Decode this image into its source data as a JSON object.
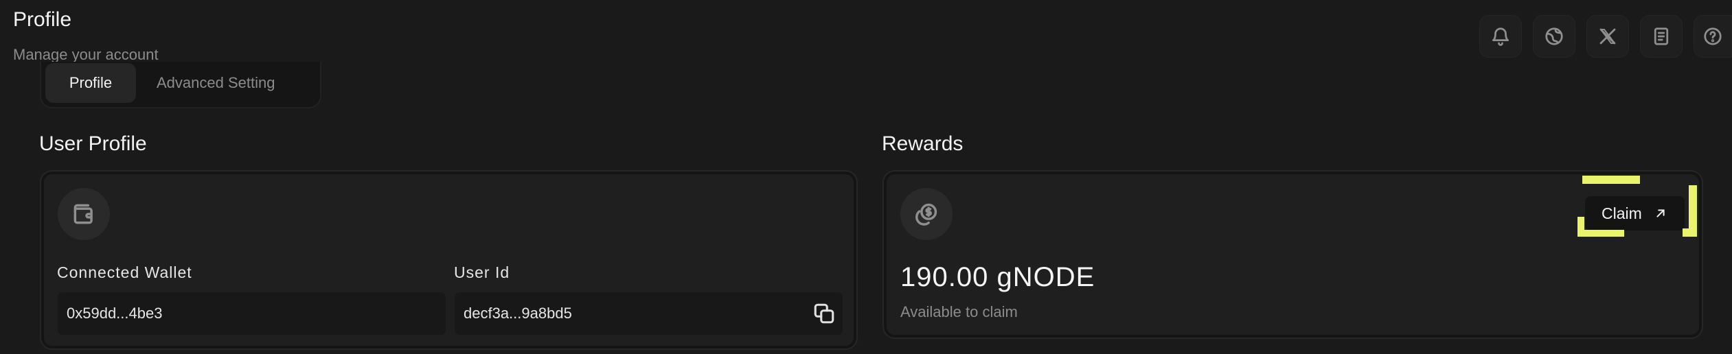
{
  "header": {
    "title": "Profile",
    "subtitle": "Manage your account"
  },
  "top_icons": [
    "bell-icon",
    "globe-icon",
    "x-twitter-icon",
    "docs-icon",
    "help-icon"
  ],
  "tabs": [
    {
      "label": "Profile",
      "active": true
    },
    {
      "label": "Advanced Setting",
      "active": false
    }
  ],
  "user_profile": {
    "section_title": "User Profile",
    "icon": "wallet-icon",
    "connected_wallet_label": "Connected Wallet",
    "connected_wallet_value": "0x59dd...4be3",
    "user_id_label": "User Id",
    "user_id_value": "decf3a...9a8bd5"
  },
  "rewards": {
    "section_title": "Rewards",
    "icon": "coins-icon",
    "amount": "190.00 gNODE",
    "caption": "Available to claim",
    "claim_label": "Claim",
    "highlight_color": "#eaf46a"
  }
}
